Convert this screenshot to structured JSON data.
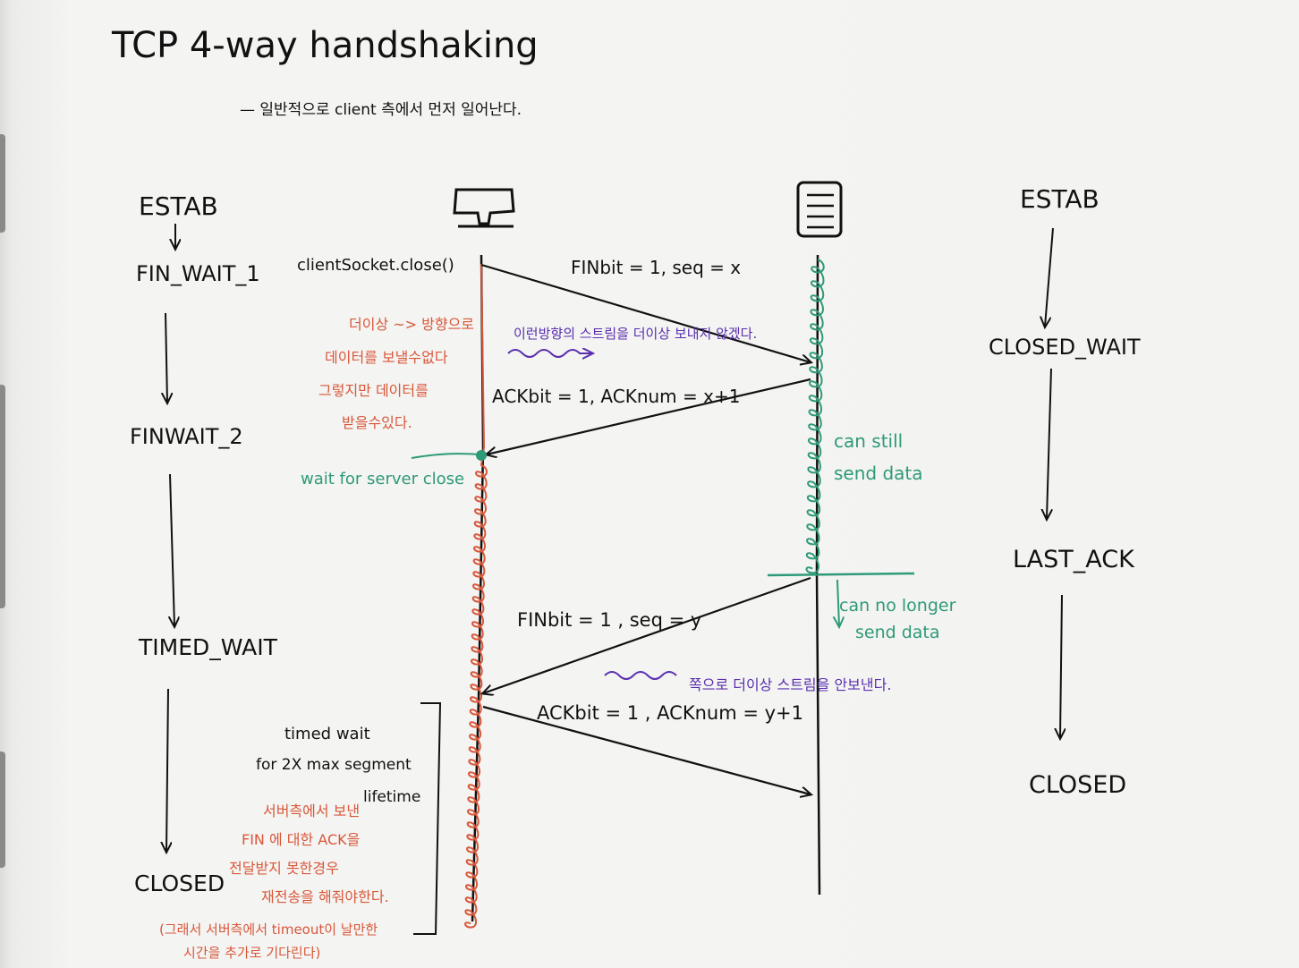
{
  "title": "TCP 4-way handshaking",
  "subtitle": "— 일반적으로 client 측에서 먼저 일어난다.",
  "client_states": {
    "estab": "ESTAB",
    "fin_wait_1": "FIN_WAIT_1",
    "fin_wait_2": "FINWAIT_2",
    "timed_wait": "TIMED_WAIT",
    "closed": "CLOSED"
  },
  "server_states": {
    "estab": "ESTAB",
    "closed_wait": "CLOSED_WAIT",
    "last_ack": "LAST_ACK",
    "closed": "CLOSED"
  },
  "icons": {
    "client": "computer-monitor-icon",
    "server": "server-icon"
  },
  "messages": {
    "close_call": "clientSocket.close()",
    "fin1": "FINbit = 1, seq = x",
    "ack1": "ACKbit = 1, ACKnum = x+1",
    "fin2": "FINbit = 1 , seq = y",
    "ack2": "ACKbit = 1 , ACKnum = y+1"
  },
  "notes": {
    "red_1": "더이상 ~> 방향으로",
    "red_2": "데이터를 보낼수없다",
    "red_3": "그렇지만 데이터를",
    "red_4": "받을수있다.",
    "purple_1": "이런방향의 스트림을 더이상 보내지 않겠다.",
    "wait_server_close": "wait for server close",
    "can_still_1": "can still",
    "can_still_2": "send data",
    "no_longer_1": "can no longer",
    "no_longer_2": "send data",
    "purple_2": "쪽으로 더이상 스트림을 안보낸다.",
    "timed_wait_1": "timed wait",
    "timed_wait_2": "for 2X max segment",
    "timed_wait_3": "lifetime",
    "red_5": "서버측에서 보낸",
    "red_6": "FIN 에 대한 ACK을",
    "red_7": "전달받지 못한경우",
    "red_8": "재전송을 해줘야한다.",
    "red_9": "(그래서 서버측에서 timeout이 날만한",
    "red_10": "시간을 추가로 기다린다)"
  },
  "colors": {
    "ink": "#111111",
    "red": "#d9573a",
    "green": "#2e9a78",
    "purple": "#5a2fb0",
    "paper": "#f2f2f0"
  }
}
